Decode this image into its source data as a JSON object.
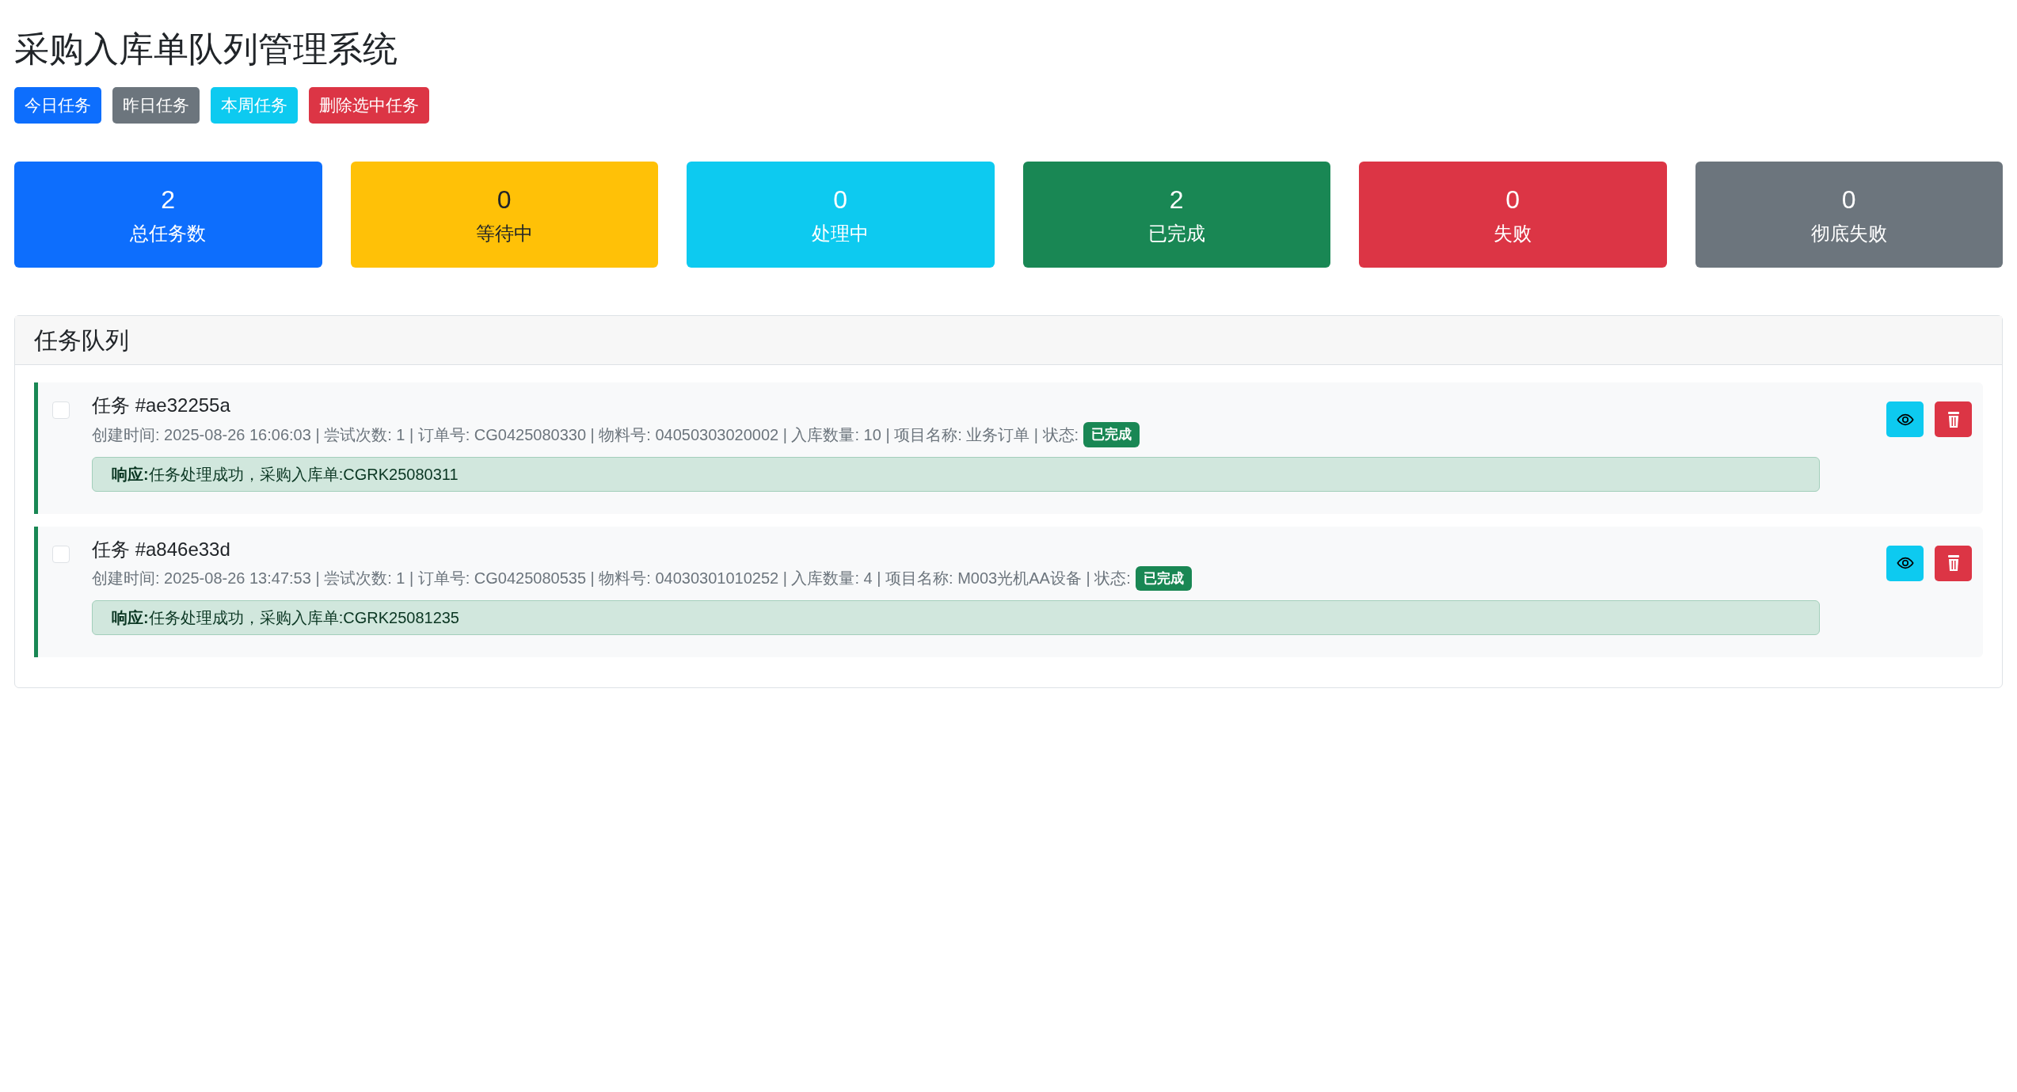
{
  "title": "采购入库单队列管理系统",
  "toolbar": [
    {
      "label": "今日任务",
      "color": "#0d6efd"
    },
    {
      "label": "昨日任务",
      "color": "#6c757d"
    },
    {
      "label": "本周任务",
      "color": "#0dcaf0"
    },
    {
      "label": "删除选中任务",
      "color": "#dc3545"
    }
  ],
  "stats": [
    {
      "value": "2",
      "label": "总任务数",
      "color": "#0d6efd"
    },
    {
      "value": "0",
      "label": "等待中",
      "color": "#ffc107"
    },
    {
      "value": "0",
      "label": "处理中",
      "color": "#0dcaf0"
    },
    {
      "value": "2",
      "label": "已完成",
      "color": "#198754"
    },
    {
      "value": "0",
      "label": "失败",
      "color": "#dc3545"
    },
    {
      "value": "0",
      "label": "彻底失败",
      "color": "#6c757d"
    }
  ],
  "queue": {
    "title": "任务队列",
    "tasks": [
      {
        "checked": false,
        "title": "任务 #ae32255a",
        "meta": "创建时间: 2025-08-26 16:06:03 | 尝试次数: 1 | 订单号: CG0425080330 | 物料号: 04050303020002 | 入库数量: 10 | 项目名称: 业务订单 | 状态:",
        "status": "已完成",
        "color": "#198754",
        "response": "**响应:**任务处理成功，采购入库单:CGRK25080311"
      },
      {
        "checked": false,
        "title": "任务 #a846e33d",
        "meta": "创建时间: 2025-08-26 13:47:53 | 尝试次数: 1 | 订单号: CG0425080535 | 物料号: 04030301010252 | 入库数量: 4 | 项目名称: M003光机AA设备 | 状态:",
        "status": "已完成",
        "color": "#198754",
        "response": "**响应:**任务处理成功，采购入库单:CGRK25081235"
      }
    ]
  }
}
